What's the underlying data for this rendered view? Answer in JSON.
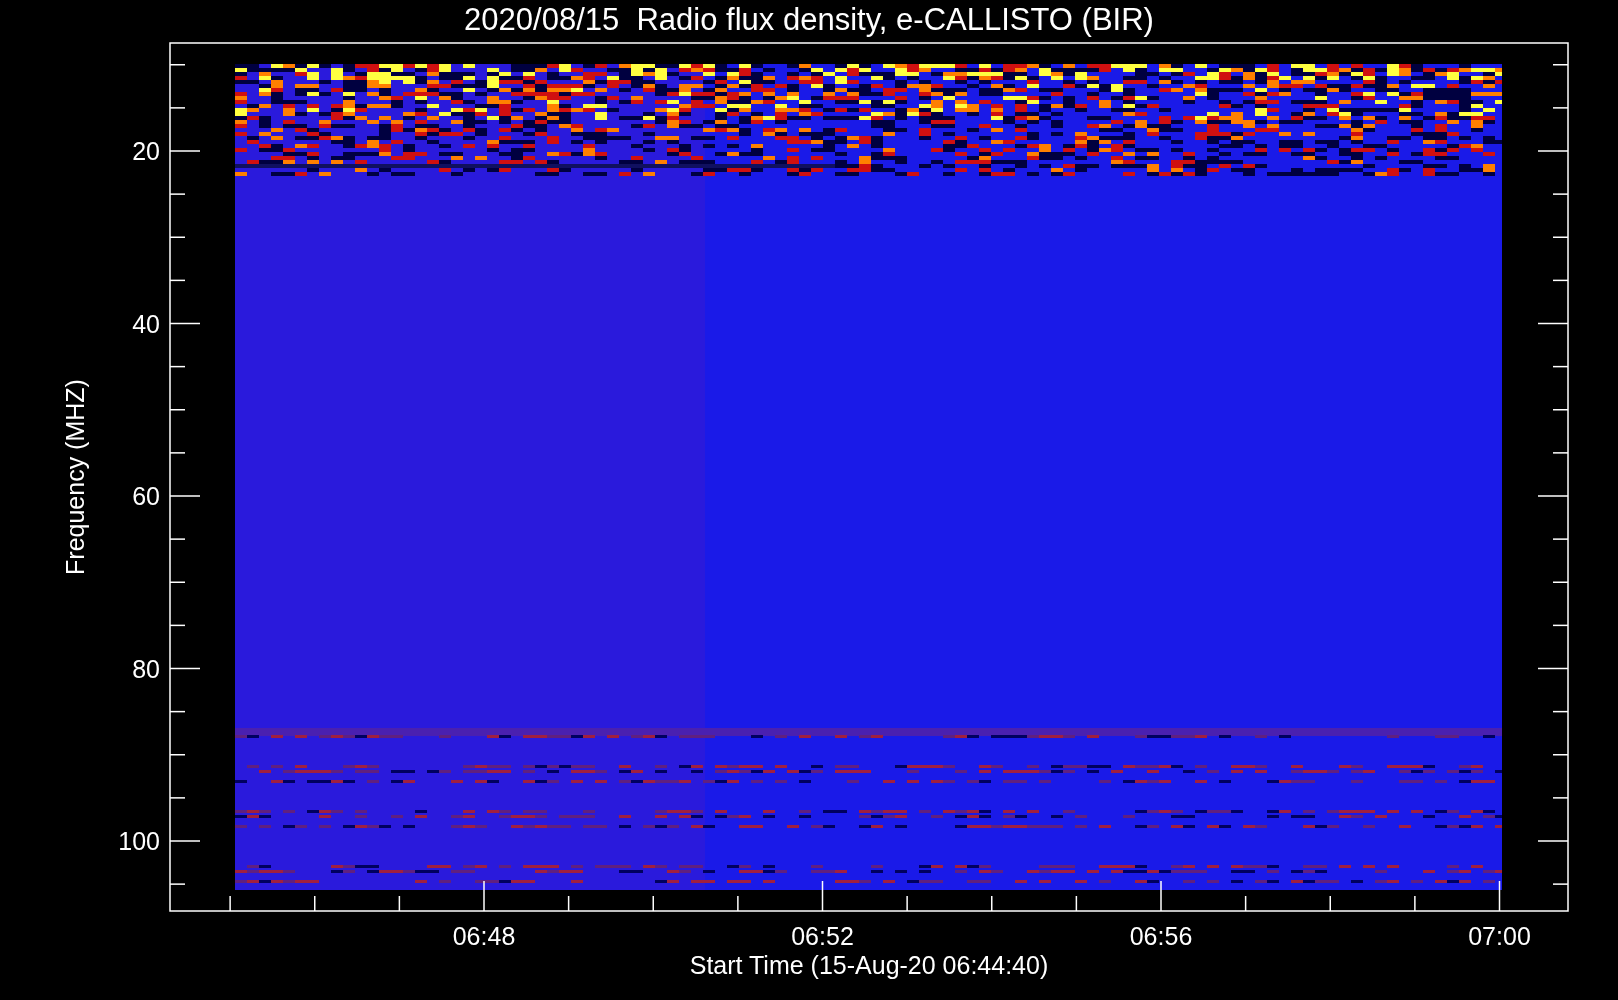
{
  "title": "2020/08/15  Radio flux density, e-CALLISTO (BIR)",
  "ylabel": "Frequency (MHZ)",
  "xlabel": "Start Time (15-Aug-20 06:44:40)",
  "yticks": [
    "20",
    "40",
    "60",
    "80",
    "100"
  ],
  "xticks": [
    "06:48",
    "06:52",
    "06:56",
    "07:00"
  ]
}
